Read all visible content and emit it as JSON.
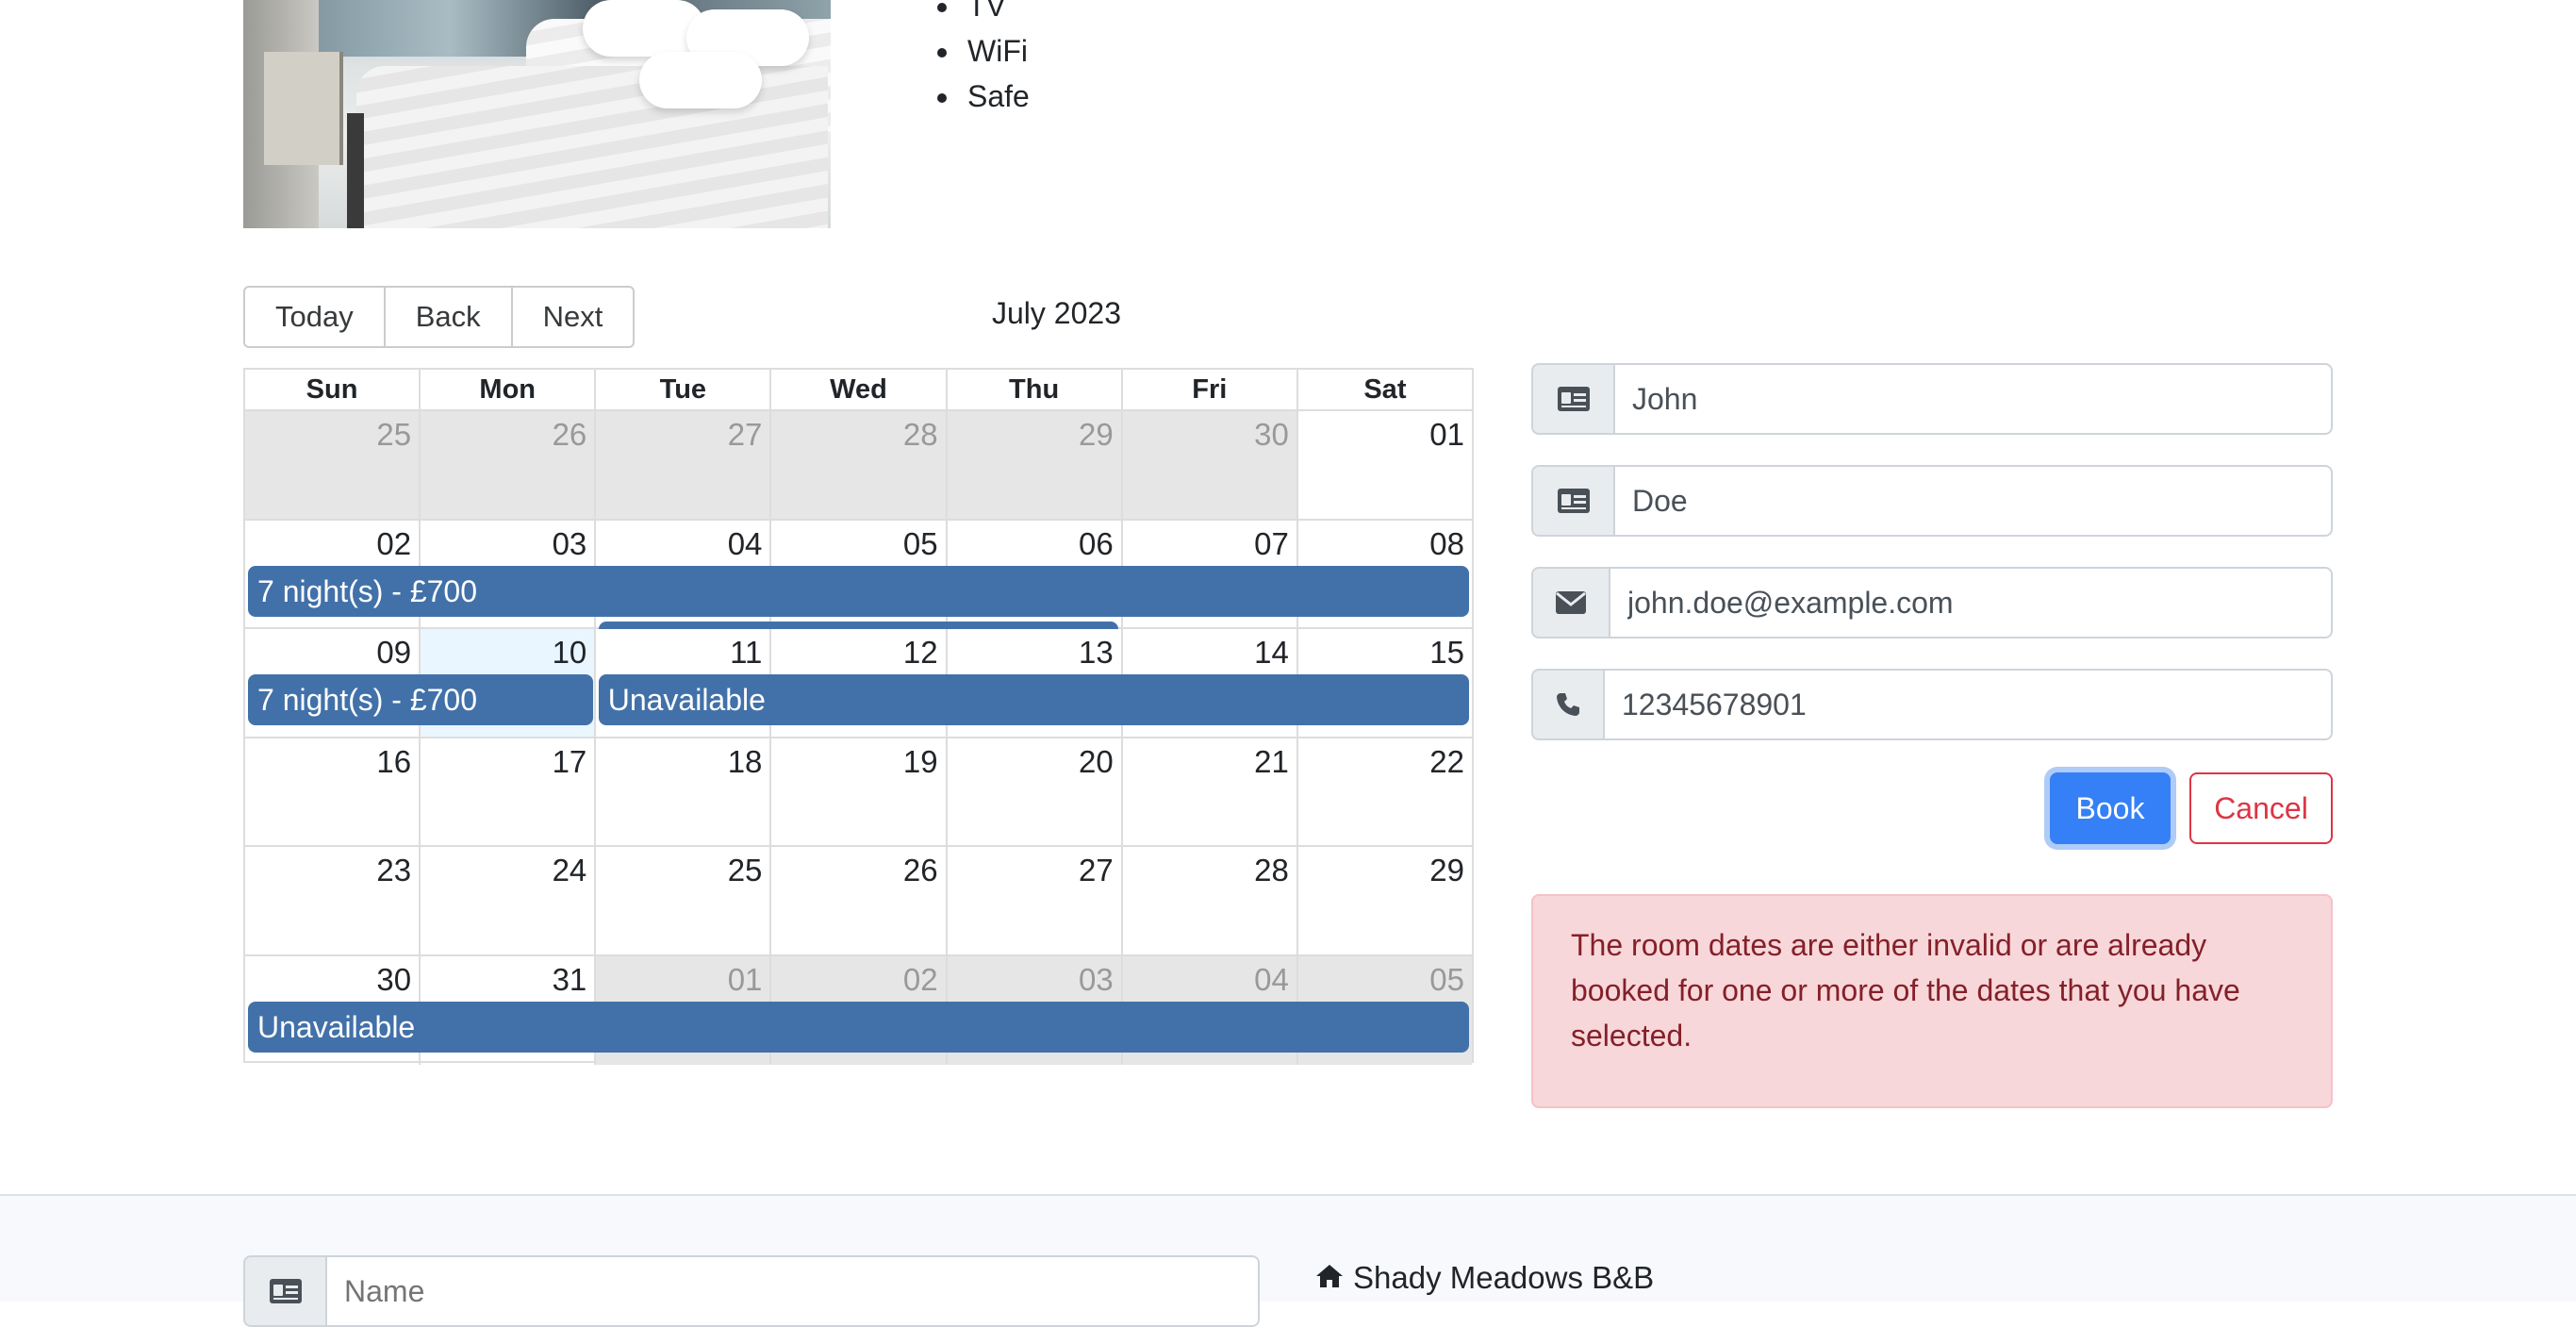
{
  "room": {
    "features": [
      "TV",
      "WiFi",
      "Safe"
    ]
  },
  "calendar": {
    "toolbar": {
      "today": "Today",
      "back": "Back",
      "next": "Next"
    },
    "month": "July 2023",
    "weekdays": [
      "Sun",
      "Mon",
      "Tue",
      "Wed",
      "Thu",
      "Fri",
      "Sat"
    ],
    "weeks": [
      {
        "days": [
          "25",
          "26",
          "27",
          "28",
          "29",
          "30",
          "01"
        ],
        "off": [
          true,
          true,
          true,
          true,
          true,
          true,
          false
        ]
      },
      {
        "days": [
          "02",
          "03",
          "04",
          "05",
          "06",
          "07",
          "08"
        ],
        "off": [
          false,
          false,
          false,
          false,
          false,
          false,
          false
        ]
      },
      {
        "days": [
          "09",
          "10",
          "11",
          "12",
          "13",
          "14",
          "15"
        ],
        "off": [
          false,
          false,
          false,
          false,
          false,
          false,
          false
        ],
        "today_index": 1
      },
      {
        "days": [
          "16",
          "17",
          "18",
          "19",
          "20",
          "21",
          "22"
        ],
        "off": [
          false,
          false,
          false,
          false,
          false,
          false,
          false
        ]
      },
      {
        "days": [
          "23",
          "24",
          "25",
          "26",
          "27",
          "28",
          "29"
        ],
        "off": [
          false,
          false,
          false,
          false,
          false,
          false,
          false
        ]
      },
      {
        "days": [
          "30",
          "31",
          "01",
          "02",
          "03",
          "04",
          "05"
        ],
        "off": [
          false,
          false,
          true,
          true,
          true,
          true,
          true
        ]
      }
    ],
    "events": {
      "week2": "7 night(s) - £700",
      "week3_a": "7 night(s) - £700",
      "week3_b": "Unavailable",
      "week6": "Unavailable"
    }
  },
  "form": {
    "firstname": "John",
    "lastname": "Doe",
    "email": "john.doe@example.com",
    "phone": "12345678901",
    "book_label": "Book",
    "cancel_label": "Cancel",
    "error": "The room dates are either invalid or are already booked for one or more of the dates that you have selected."
  },
  "footer": {
    "name_placeholder": "Name",
    "brand": "Shady Meadows B&B"
  },
  "colors": {
    "event": "#4271a9",
    "primary": "#3580f7",
    "danger": "#dc3545",
    "alert_bg": "#f8d7da"
  }
}
